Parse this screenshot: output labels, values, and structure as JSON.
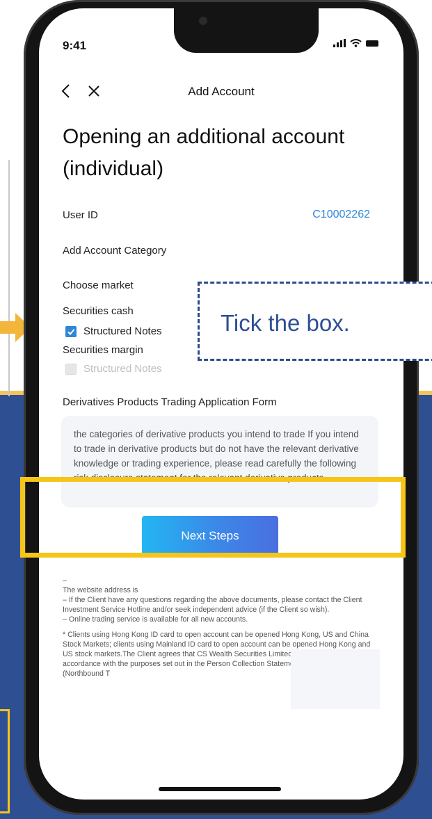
{
  "status_bar": {
    "time": "9:41"
  },
  "nav": {
    "title": "Add Account"
  },
  "page": {
    "title": "Opening an additional account (individual)"
  },
  "user_id": {
    "label": "User ID",
    "value": "C10002262"
  },
  "add_account_category": {
    "label": "Add Account Category"
  },
  "choose_market": {
    "label": "Choose market"
  },
  "securities_cash": {
    "label": "Securities cash",
    "option": {
      "label": "Structured Notes",
      "checked": true
    }
  },
  "securities_margin": {
    "label": "Securities margin",
    "option": {
      "label": "Structured Notes",
      "checked": false,
      "disabled": true
    }
  },
  "derivatives": {
    "title": "Derivatives Products Trading Application Form",
    "text": "the categories of derivative products you intend to trade If you intend to trade in derivative products but do not have the relevant derivative knowledge or trading experience, please read carefully the following risk disclosure statement for the relevant derivative products."
  },
  "next_button": {
    "label": "Next Steps"
  },
  "notes": {
    "dash": "–",
    "line1": "The website address is",
    "line2": "– If the Client have any questions regarding the above documents, please contact the Client Investment Service Hotline and/or seek independent advice (if the Client so wish).",
    "line3": "– Online trading service is available for all new accounts.",
    "line4": "* Clients using Hong Kong ID card to open account can be opened Hong Kong, US and China Stock Markets; clients using Mainland ID card to open account can be opened Hong Kong and US stock markets.The Client agrees that CS Wealth Securities Limited may use the Clier data in accordance with the purposes set out in the Person Collection Statement in relation to the CETS (Northbound T"
  },
  "callout": {
    "text": "Tick the box."
  },
  "colors": {
    "accent_blue": "#2f86d6",
    "background_blue": "#2f4f93",
    "highlight_yellow": "#f5c518"
  }
}
